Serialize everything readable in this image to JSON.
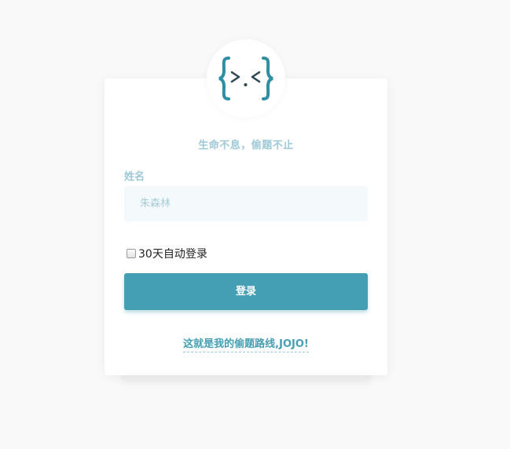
{
  "logo": {
    "icon": "code-face-icon",
    "colors": {
      "brace": "#2e8fa3",
      "face": "#2b4652"
    }
  },
  "tagline": "生命不息，偷题不止",
  "form": {
    "name_label": "姓名",
    "name_placeholder": "朱森林",
    "name_value": "",
    "remember_label": "30天自动登录",
    "remember_checked": false,
    "submit_label": "登录"
  },
  "footer": {
    "link_text": "这就是我的偷题路线,JOJO!"
  },
  "colors": {
    "accent": "#449fb4",
    "muted": "#9ec8d6",
    "input_bg": "#f4f9fb",
    "page_bg": "#f9f9f9"
  }
}
